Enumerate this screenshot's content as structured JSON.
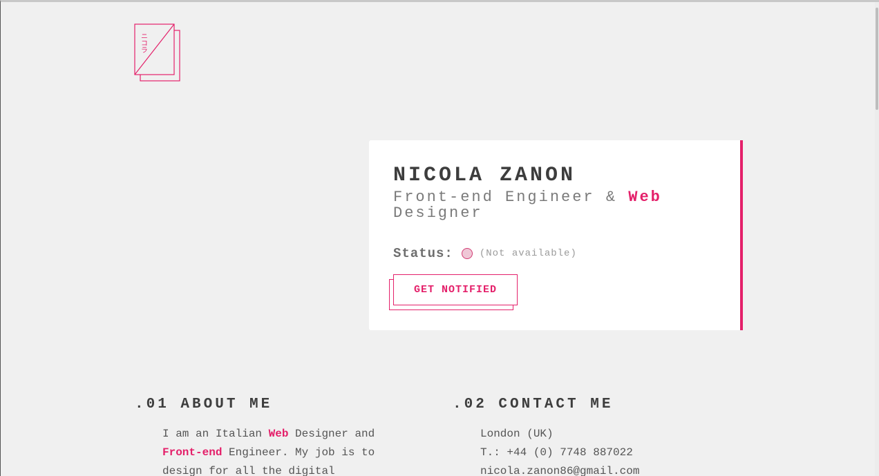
{
  "logo": {
    "glyphs": "ニコラ"
  },
  "profile": {
    "name": "NICOLA ZANON",
    "subtitle_pre": "Front-end Engineer & ",
    "subtitle_highlight": "Web",
    "subtitle_post": "Designer",
    "status_label": "Status:",
    "status_text": "(Not available)",
    "notify_button": "GET NOTIFIED"
  },
  "about": {
    "title": ".01 ABOUT ME",
    "text_1": "I am an Italian ",
    "hl_1": "Web",
    "text_2": " Designer and ",
    "hl_2": "Front-end",
    "text_3": " Engineer. My job is to design for all the digital"
  },
  "contact": {
    "title": ".02 CONTACT ME",
    "location": "London (UK)",
    "phone": "T.: +44 (0) 7748 887022",
    "email": "nicola.zanon86@gmail.com"
  },
  "colors": {
    "accent": "#e4206a",
    "background": "#f0f0f0",
    "card": "#ffffff",
    "text": "#444444",
    "status_dot": "#efc7d6"
  }
}
